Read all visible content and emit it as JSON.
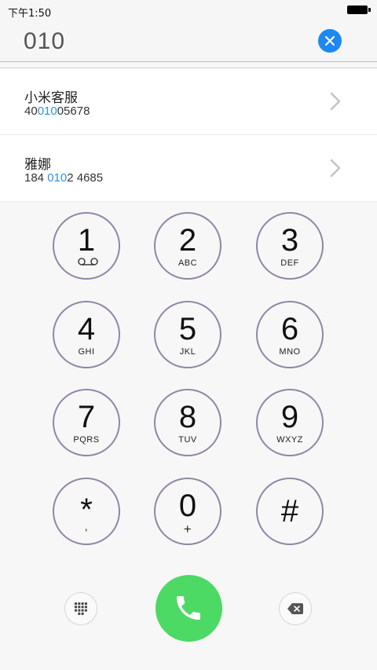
{
  "status_bar": {
    "time": "下午1:50"
  },
  "dial": {
    "number": "010"
  },
  "contacts": [
    {
      "name": "小米客服",
      "number_before": "40",
      "number_match": "010",
      "number_after": "05678"
    },
    {
      "name": "雅娜",
      "number_before": "184 ",
      "number_match": "010",
      "number_after": "2 4685"
    }
  ],
  "keypad": {
    "keys": [
      {
        "digit": "1",
        "letters": ""
      },
      {
        "digit": "2",
        "letters": "ABC"
      },
      {
        "digit": "3",
        "letters": "DEF"
      },
      {
        "digit": "4",
        "letters": "GHI"
      },
      {
        "digit": "5",
        "letters": "JKL"
      },
      {
        "digit": "6",
        "letters": "MNO"
      },
      {
        "digit": "7",
        "letters": "PQRS"
      },
      {
        "digit": "8",
        "letters": "TUV"
      },
      {
        "digit": "9",
        "letters": "WXYZ"
      },
      {
        "digit": "*",
        "letters": ","
      },
      {
        "digit": "0",
        "letters": "+"
      },
      {
        "digit": "#",
        "letters": ""
      }
    ]
  },
  "icons": {
    "clear": "close-icon",
    "chevron": "chevron-right-icon",
    "voicemail": "voicemail-icon",
    "keypad_toggle": "dialpad-icon",
    "call": "phone-icon",
    "delete": "backspace-icon"
  },
  "colors": {
    "accent": "#1e88f0",
    "match_highlight": "#2f8ee6",
    "call": "#4cd964",
    "key_border": "#8f87a5"
  }
}
